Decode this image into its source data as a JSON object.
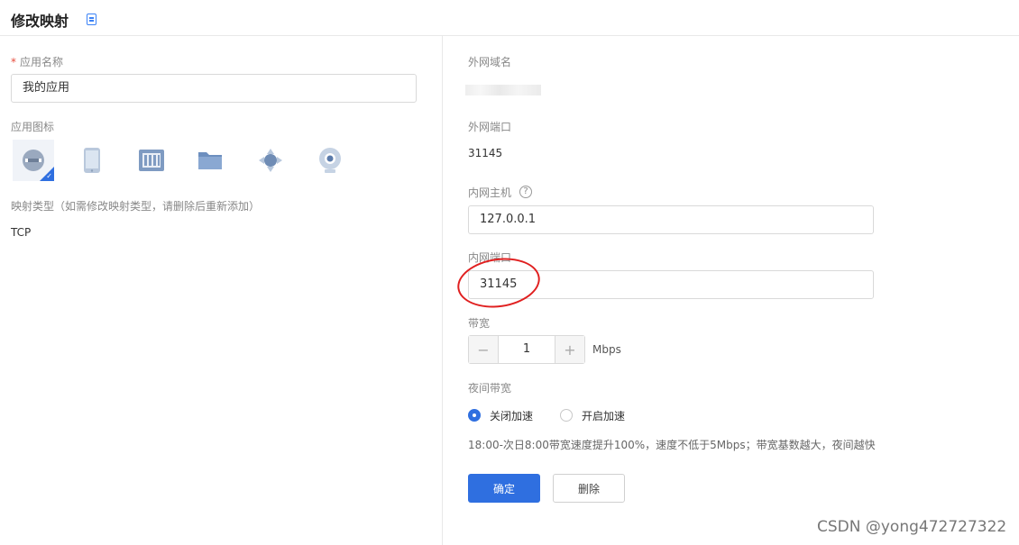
{
  "header": {
    "title": "修改映射"
  },
  "left": {
    "app_name_label": "应用名称",
    "required_mark": "*",
    "app_name_value": "我的应用",
    "app_icon_label": "应用图标",
    "icons": [
      "ie-icon",
      "tablet-icon",
      "nas-icon",
      "folder-icon",
      "remote-icon",
      "webcam-icon"
    ],
    "mapping_type_label": "映射类型（如需修改映射类型，请删除后重新添加）",
    "mapping_type_value": "TCP"
  },
  "right": {
    "ext_domain_label": "外网域名",
    "ext_port_label": "外网端口",
    "ext_port_value": "31145",
    "int_host_label": "内网主机",
    "help_glyph": "?",
    "int_host_value": "127.0.0.1",
    "int_port_label": "内网端口",
    "int_port_value": "31145",
    "bandwidth_label": "带宽",
    "bandwidth_minus": "−",
    "bandwidth_value": "1",
    "bandwidth_plus": "+",
    "bandwidth_unit": "Mbps",
    "night_bandwidth_label": "夜间带宽",
    "option_off": "关闭加速",
    "option_on": "开启加速",
    "night_note": "18:00-次日8:00带宽速度提升100%，速度不低于5Mbps；带宽基数越大，夜间越快",
    "confirm_button": "确定",
    "delete_button": "删除"
  },
  "watermark": "CSDN @yong472727322",
  "colors": {
    "primary": "#2f6fe0",
    "annotation": "#e02020"
  }
}
